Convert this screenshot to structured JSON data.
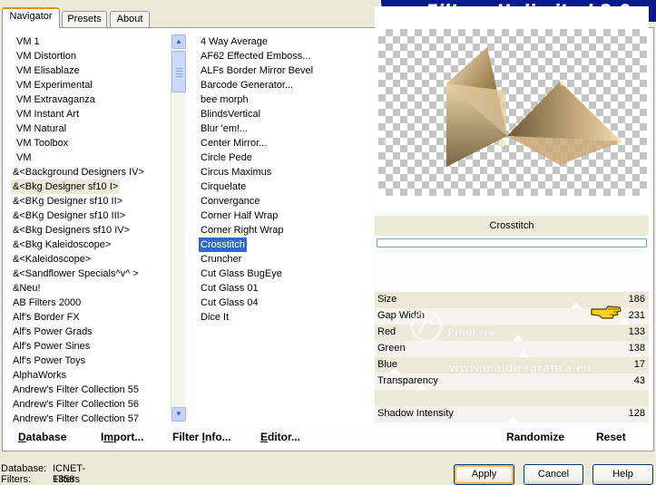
{
  "tabs": [
    {
      "label": "Navigator",
      "active": true
    },
    {
      "label": "Presets",
      "active": false
    },
    {
      "label": "About",
      "active": false
    }
  ],
  "app_title": "Filters Unlimited 2.0",
  "categories": [
    "VM 1",
    "VM Distortion",
    "VM Elisablaze",
    "VM Experimental",
    "VM Extravaganza",
    "VM Instant Art",
    "VM Natural",
    "VM Toolbox",
    "VM",
    "&<Background Designers IV>",
    "&<Bkg Designer sf10 I>",
    "&<BKg Designer sf10 II>",
    "&<BKg Designer sf10 III>",
    "&<Bkg Designers sf10 IV>",
    "&<Bkg Kaleidoscope>",
    "&<Kaleidoscope>",
    "&<Sandflower Specials^v^ >",
    "&Neu!",
    "AB Filters 2000",
    "Alf's Border FX",
    "Alf's Power Grads",
    "Alf's Power Sines",
    "Alf's Power Toys",
    "AlphaWorks",
    "Andrew's Filter Collection 55",
    "Andrew's Filter Collection 56",
    "Andrew's Filter Collection 57"
  ],
  "selected_category": "&<Bkg Designer sf10 I>",
  "filters": [
    "4 Way Average",
    "AF62 Effected Emboss...",
    "ALFs Border Mirror Bevel",
    "Barcode Generator...",
    "bee morph",
    "BlindsVertical",
    "Blur 'em!...",
    "Center Mirror...",
    "Circle Pede",
    "Circus Maximus",
    "Cirquelate",
    "Convergance",
    "Corner Half Wrap",
    "Corner Right Wrap",
    "Crosstitch",
    "Cruncher",
    "Cut Glass  BugEye",
    "Cut Glass 01",
    "Cut Glass 04",
    "Dice It"
  ],
  "selected_filter": "Crosstitch",
  "preview": {
    "filter_name": "Crosstitch"
  },
  "parameters": [
    {
      "label": "Size",
      "value": "186",
      "level": 0.73
    },
    {
      "label": "Gap Width",
      "value": "231",
      "level": 0.91
    },
    {
      "label": "Red",
      "value": "133",
      "level": 0.52
    },
    {
      "label": "Green",
      "value": "138",
      "level": 0.54
    },
    {
      "label": "Blue",
      "value": "17",
      "level": 0.07
    },
    {
      "label": "Transparency",
      "value": "43",
      "level": 0.17
    },
    {
      "label": "",
      "value": "",
      "level": null
    },
    {
      "label": "Shadow Intensity",
      "value": "128",
      "level": 0.5
    }
  ],
  "toolbar": {
    "database": {
      "u": "D",
      "rest": "atabase"
    },
    "import": {
      "a": "I",
      "u": "m",
      "rest": "port..."
    },
    "filter_info": {
      "a": "Filter ",
      "u": "I",
      "rest": "nfo..."
    },
    "editor": {
      "u": "E",
      "rest": "ditor..."
    },
    "randomize": "Randomize",
    "reset": "Reset"
  },
  "status": {
    "database_label": "Database:",
    "database_value": "ICNET-Filters",
    "filters_label": "Filters:",
    "filters_value": "1358"
  },
  "buttons": {
    "apply": "Apply",
    "cancel": "Cancel",
    "help": "Help"
  },
  "watermark": {
    "name": "Pinuccia",
    "url": "www.maldiregrafica.eu"
  },
  "colors": {
    "selection": "#316ac5",
    "banner": "#0a1a8c",
    "tab_highlight": "#e68b2c"
  }
}
